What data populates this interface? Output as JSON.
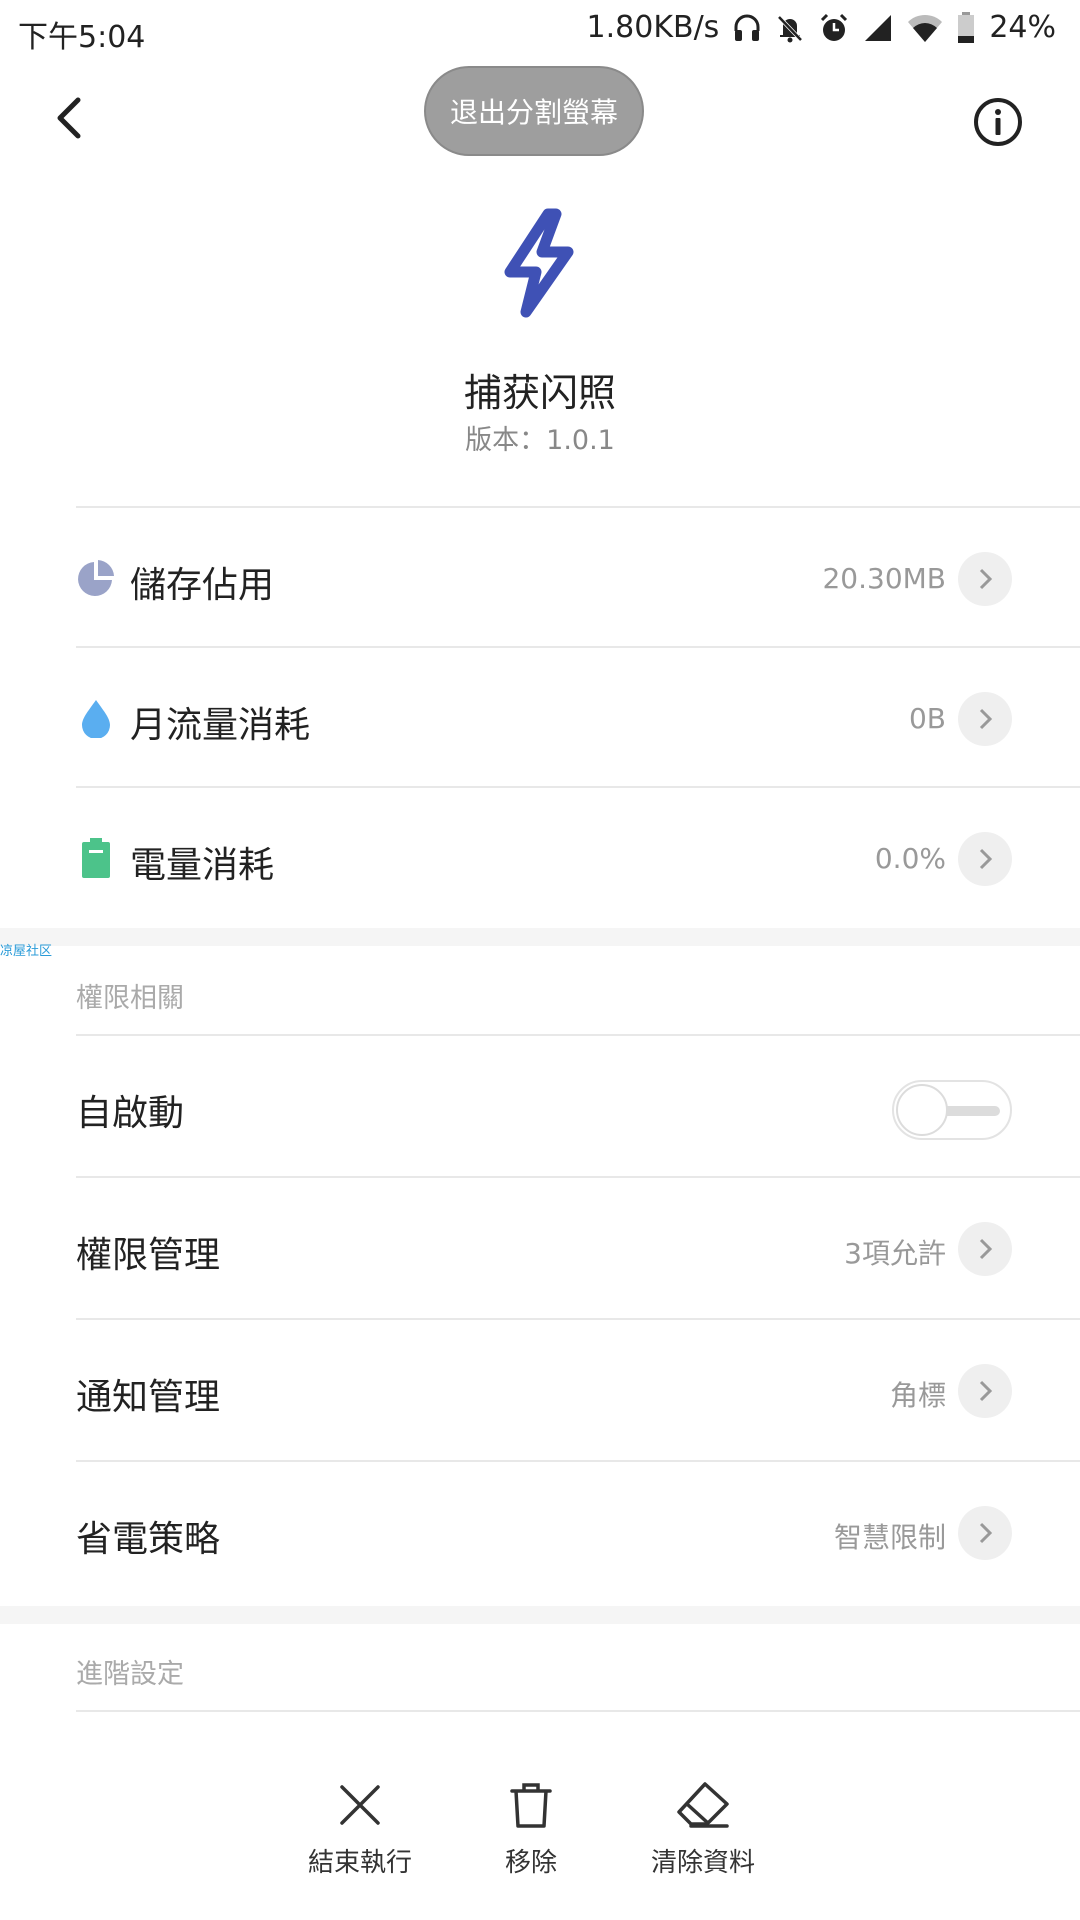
{
  "status_bar": {
    "time": "下午5:04",
    "net_speed": "1.80KB/s",
    "battery": "24%",
    "icons": [
      "headphones-icon",
      "bell-off-icon",
      "alarm-icon",
      "signal-icon",
      "wifi-icon",
      "battery-icon"
    ]
  },
  "header": {
    "split_screen_label": "退出分割螢幕",
    "back_icon": "chevron-left-icon",
    "info_icon": "info-icon"
  },
  "app": {
    "name": "捕获闪照",
    "version": "版本：1.0.1",
    "icon": "lightning-bolt-icon",
    "icon_color": "#3f51b5"
  },
  "usage": [
    {
      "label": "儲存佔用",
      "value": "20.30MB",
      "icon": "pie-chart-icon",
      "color": "#9aa3c8"
    },
    {
      "label": "月流量消耗",
      "value": "0B",
      "icon": "water-drop-icon",
      "color": "#5aaef0"
    },
    {
      "label": "電量消耗",
      "value": "0.0%",
      "icon": "battery-icon",
      "color": "#4cc38a"
    }
  ],
  "watermark": "凉屋社区",
  "permissions": {
    "title": "權限相關",
    "autostart": {
      "label": "自啟動",
      "enabled": false
    },
    "items": [
      {
        "label": "權限管理",
        "value": "3項允許"
      },
      {
        "label": "通知管理",
        "value": "角標"
      },
      {
        "label": "省電策略",
        "value": "智慧限制"
      }
    ]
  },
  "advanced": {
    "title": "進階設定"
  },
  "actions": [
    {
      "label": "結束執行",
      "icon": "close-icon"
    },
    {
      "label": "移除",
      "icon": "trash-icon"
    },
    {
      "label": "清除資料",
      "icon": "eraser-icon"
    }
  ]
}
